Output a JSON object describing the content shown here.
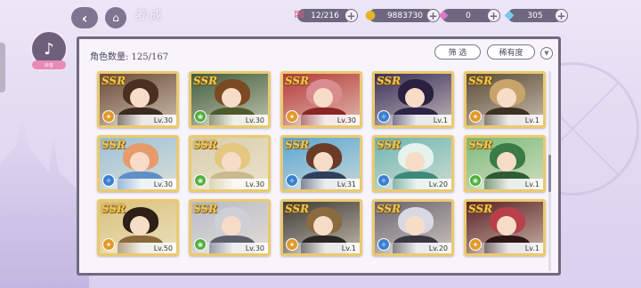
{
  "header": {
    "title": "养成",
    "resources": [
      {
        "icon": "stamina-ticket-icon",
        "value": "12/216"
      },
      {
        "icon": "gold-coin-icon",
        "value": "9883730"
      },
      {
        "icon": "pink-gem-icon",
        "value": "0"
      },
      {
        "icon": "blue-diamond-icon",
        "value": "305"
      }
    ]
  },
  "side": {
    "app_tag": "抖音"
  },
  "panel": {
    "count_label": "角色数量: 125/167",
    "filter_label": "筛 选",
    "rarity_label": "稀有度",
    "sort_icon": "sort-toggle-icon"
  },
  "cards": [
    {
      "rarity": "SSR",
      "level": "Lv.30",
      "attr": "orange",
      "hair": "#4a3021",
      "bg": "#6b4a38",
      "outfit": "#3b2a22"
    },
    {
      "rarity": "SSR",
      "level": "Lv.30",
      "attr": "green",
      "hair": "#7b4a22",
      "bg": "#3f5d3e",
      "outfit": "#4f5a2c"
    },
    {
      "rarity": "SSR",
      "level": "Lv.30",
      "attr": "orange",
      "hair": "#d98c90",
      "bg": "#b43a3a",
      "outfit": "#8a2626"
    },
    {
      "rarity": "SSR",
      "level": "Lv.1",
      "attr": "blue",
      "hair": "#2a2140",
      "bg": "#3b2f5a",
      "outfit": "#2d2548"
    },
    {
      "rarity": "SSR",
      "level": "Lv.1",
      "attr": "orange",
      "hair": "#c9a46a",
      "bg": "#5b4a38",
      "outfit": "#3e3022"
    },
    {
      "rarity": "SSR",
      "level": "Lv.30",
      "attr": "blue",
      "hair": "#e79a6c",
      "bg": "#9cc1d6",
      "outfit": "#5f8fc6"
    },
    {
      "rarity": "SSR",
      "level": "Lv.30",
      "attr": "green",
      "hair": "#e4c780",
      "bg": "#d8cfae",
      "outfit": "#c9b98d"
    },
    {
      "rarity": "SSR",
      "level": "Lv.31",
      "attr": "blue",
      "hair": "#6a3c28",
      "bg": "#5aa6d4",
      "outfit": "#2f3f5a"
    },
    {
      "rarity": "SSR",
      "level": "Lv.20",
      "attr": "blue",
      "hair": "#e6f2ee",
      "bg": "#6fb6b4",
      "outfit": "#3e8a7a"
    },
    {
      "rarity": "SSR",
      "level": "Lv.1",
      "attr": "green",
      "hair": "#3c7a46",
      "bg": "#7dbb7c",
      "outfit": "#2f5a33"
    },
    {
      "rarity": "SSR",
      "level": "Lv.50",
      "attr": "orange",
      "hair": "#2e2016",
      "bg": "#d9c37c",
      "outfit": "#8a6a3a"
    },
    {
      "rarity": "SSR",
      "level": "Lv.30",
      "attr": "green",
      "hair": "#cfcfd6",
      "bg": "#b9bcc8",
      "outfit": "#5c5f70"
    },
    {
      "rarity": "SSR",
      "level": "Lv.1",
      "attr": "orange",
      "hair": "#8a6a3e",
      "bg": "#3e3a36",
      "outfit": "#2a2724"
    },
    {
      "rarity": "SSR",
      "level": "Lv.20",
      "attr": "blue",
      "hair": "#d9d9e2",
      "bg": "#6a6472",
      "outfit": "#3a3644"
    },
    {
      "rarity": "SSR",
      "level": "Lv.1",
      "attr": "orange",
      "hair": "#b8404a",
      "bg": "#5a2226",
      "outfit": "#2e1618"
    }
  ],
  "colors": {
    "attr_orange": "#e39a2a",
    "attr_green": "#4fae3c",
    "attr_blue": "#3a7fd0",
    "card_border": "#eac970",
    "panel_border": "#6f6a80"
  }
}
